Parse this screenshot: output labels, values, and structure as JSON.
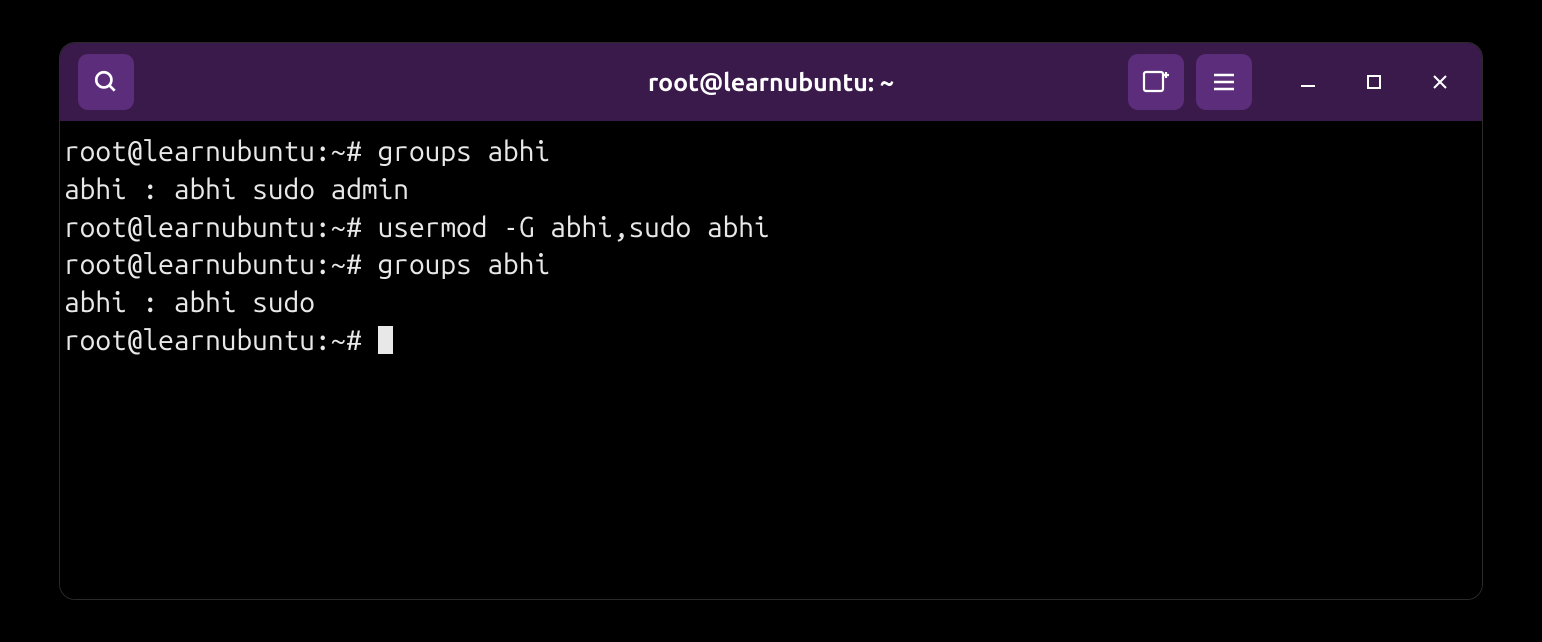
{
  "titlebar": {
    "title": "root@learnubuntu: ~"
  },
  "terminal": {
    "prompt": "root@learnubuntu:~# ",
    "lines": {
      "l0_command": "groups abhi",
      "l1_output": "abhi : abhi sudo admin",
      "l2_command": "usermod -G abhi,sudo abhi",
      "l3_command": "groups abhi",
      "l4_output": "abhi : abhi sudo"
    }
  },
  "icons": {
    "search": "search-icon",
    "new_tab": "new-tab-icon",
    "menu": "hamburger-menu-icon",
    "minimize": "minimize-icon",
    "maximize": "maximize-icon",
    "close": "close-icon"
  }
}
